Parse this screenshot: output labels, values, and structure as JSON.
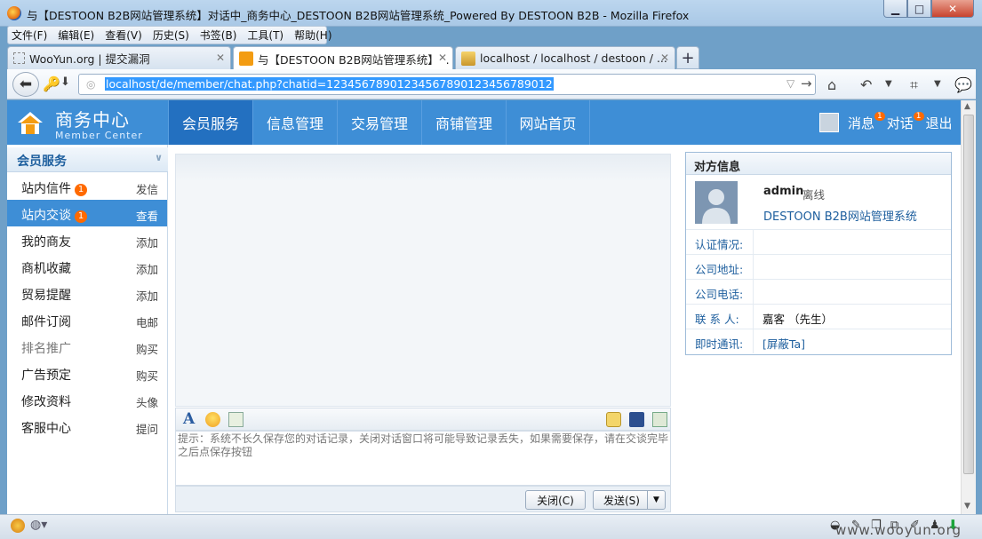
{
  "window": {
    "title": "与【DESTOON B2B网站管理系统】对话中_商务中心_DESTOON B2B网站管理系统_Powered By DESTOON B2B - Mozilla Firefox"
  },
  "menu": [
    "文件(F)",
    "编辑(E)",
    "查看(V)",
    "历史(S)",
    "书签(B)",
    "工具(T)",
    "帮助(H)"
  ],
  "tabs": [
    {
      "label": "WooYun.org | 提交漏洞"
    },
    {
      "label": "与【DESTOON B2B网站管理系统】..."
    },
    {
      "label": "localhost / localhost / destoon / ..."
    }
  ],
  "url": "localhost/de/member/chat.php?chatid=12345678901234567890123456789012",
  "header": {
    "logo_title": "商务中心",
    "logo_subtitle": "Member Center",
    "nav": [
      "会员服务",
      "信息管理",
      "交易管理",
      "商铺管理",
      "网站首页"
    ],
    "messages": "消息",
    "messages_count": "1",
    "talk": "对话",
    "talk_count": "1",
    "logout": "退出"
  },
  "sidebar": {
    "title": "会员服务",
    "items": [
      {
        "label": "站内信件",
        "badge": "1",
        "action": "发信"
      },
      {
        "label": "站内交谈",
        "badge": "1",
        "action": "查看"
      },
      {
        "label": "我的商友",
        "action": "添加"
      },
      {
        "label": "商机收藏",
        "action": "添加"
      },
      {
        "label": "贸易提醒",
        "action": "添加"
      },
      {
        "label": "邮件订阅",
        "action": "电邮"
      },
      {
        "label": "排名推广",
        "action": "购买"
      },
      {
        "label": "广告预定",
        "action": "购买"
      },
      {
        "label": "修改资料",
        "action": "头像"
      },
      {
        "label": "客服中心",
        "action": "提问"
      }
    ]
  },
  "chat": {
    "input_hint": "提示：系统不长久保存您的对话记录，关闭对话窗口将可能导致记录丢失，如果需要保存，请在交谈完毕之后点保存按钮",
    "close_label": "关闭(C)",
    "send_label": "发送(S)"
  },
  "info": {
    "title": "对方信息",
    "name": "admin",
    "status": "离线",
    "company": "DESTOON B2B网站管理系统",
    "rows": [
      {
        "key": "认证情况:",
        "value": ""
      },
      {
        "key": "公司地址:",
        "value": ""
      },
      {
        "key": "公司电话:",
        "value": ""
      },
      {
        "key": "联 系 人:",
        "value": "嘉客 （先生）"
      },
      {
        "key": "即时通讯:",
        "value": "[屏蔽Ta]"
      }
    ]
  },
  "watermark": "www.wooyun.org",
  "colors": {
    "accent": "#3e8ed6",
    "badge": "#ff6a00"
  }
}
